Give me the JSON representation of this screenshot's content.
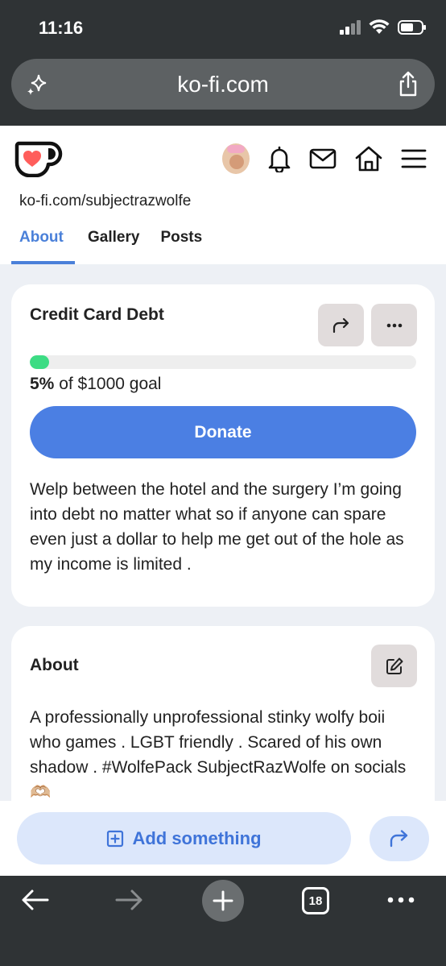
{
  "status_bar": {
    "time": "11:16"
  },
  "browser": {
    "url": "ko-fi.com",
    "tabs_count": "18"
  },
  "site": {
    "slug": "ko-fi.com/subjectrazwolfe",
    "tabs": [
      {
        "label": "About",
        "active": true
      },
      {
        "label": "Gallery",
        "active": false
      },
      {
        "label": "Posts",
        "active": false
      }
    ]
  },
  "goal_card": {
    "title": "Credit Card Debt",
    "progress_fraction": 0.05,
    "progress_percent": "5%",
    "goal_text": " of $1000 goal",
    "donate_label": "Donate",
    "description": "Welp between the hotel and the surgery I’m going into debt no matter what so if anyone can spare even just a dollar to help me get out of the hole as my income is limited ."
  },
  "about_card": {
    "title": "About",
    "text": "A professionally unprofessional stinky wolfy boii who games . LGBT friendly . Scared of his own shadow . #WolfePack SubjectRazWolfe on socials 🫶🏼"
  },
  "actions": {
    "add_label": "Add something"
  },
  "colors": {
    "accent": "#4b7fe3",
    "progress": "#3ddc84",
    "browser_chrome": "#2f3335",
    "kofi_red": "#ff5e5b"
  }
}
